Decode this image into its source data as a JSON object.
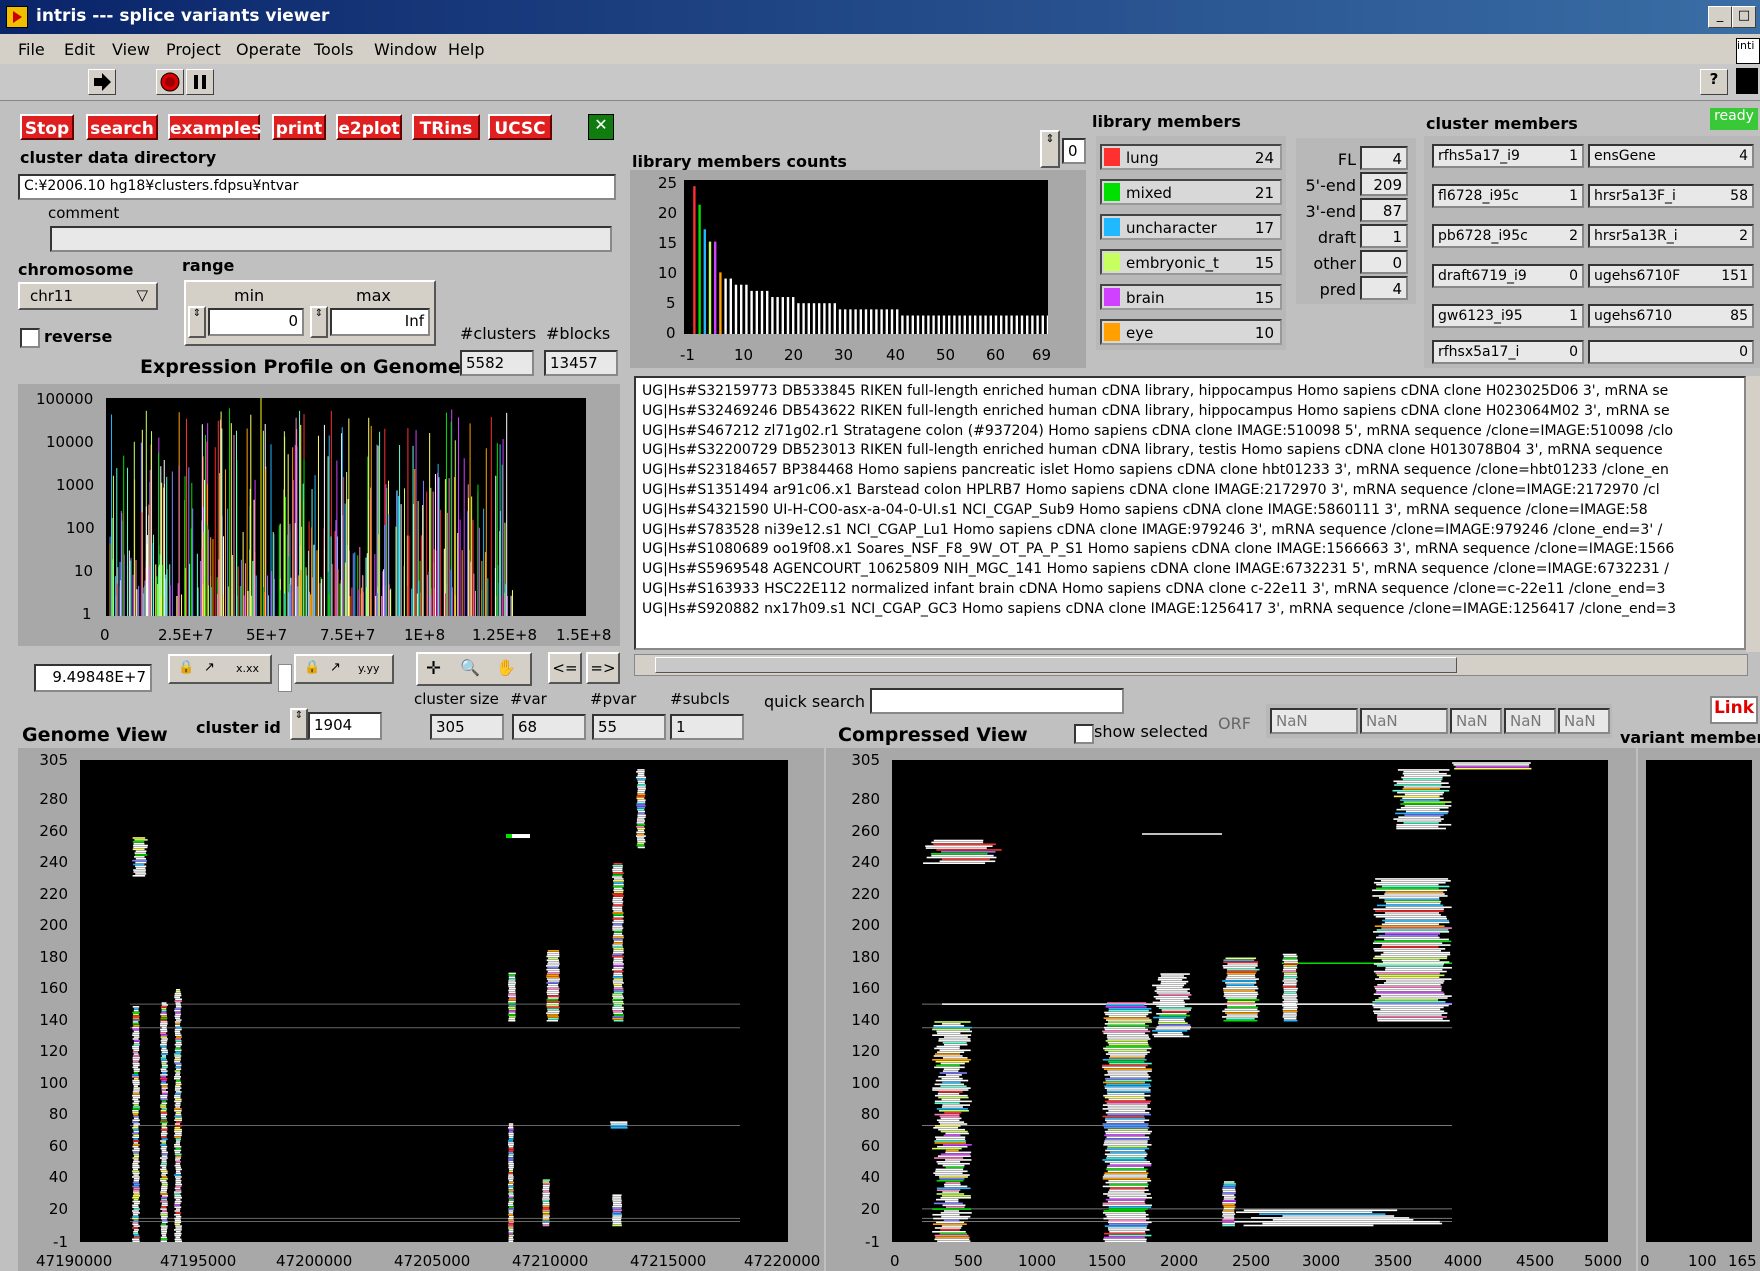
{
  "window": {
    "title": "intris --- splice variants viewer"
  },
  "menu": [
    "File",
    "Edit",
    "View",
    "Project",
    "Operate",
    "Tools",
    "Window",
    "Help"
  ],
  "toolbar": {
    "help": "?"
  },
  "buttons": {
    "stop": "Stop",
    "search": "search",
    "examples": "examples",
    "print": "print",
    "e2plot": "e2plot",
    "trins": "TRins",
    "ucsc": "UCSC"
  },
  "cluster_dir": {
    "label": "cluster data directory",
    "value": "C:¥2006.10 hg18¥clusters.fdpsu¥ntvar",
    "comment_label": "comment",
    "comment": ""
  },
  "chromosome": {
    "label": "chromosome",
    "value": "chr11",
    "reverse_label": "reverse"
  },
  "range": {
    "label": "range",
    "min_label": "min",
    "max_label": "max",
    "min": "0",
    "max": "Inf"
  },
  "counts": {
    "clusters_label": "#clusters",
    "blocks_label": "#blocks",
    "clusters": "5582",
    "blocks": "13457"
  },
  "expression": {
    "title": "Expression Profile on Genome",
    "y_ticks": [
      "100000",
      "10000",
      "1000",
      "100",
      "10",
      "1"
    ],
    "x_ticks": [
      "0",
      "2.5E+7",
      "5E+7",
      "7.5E+7",
      "1E+8",
      "1.25E+8",
      "1.5E+8"
    ],
    "cursor_value": "9.49848E+7",
    "tool_x_fmt": "x.xx",
    "tool_y_fmt": "y.yy",
    "prev": "<=",
    "next": "=>"
  },
  "lib_counts": {
    "title": "library members counts",
    "spin": "0",
    "y_ticks": [
      "25",
      "20",
      "15",
      "10",
      "5",
      "0"
    ],
    "x_ticks": [
      "-1",
      "10",
      "20",
      "30",
      "40",
      "50",
      "60",
      "69"
    ],
    "chart_data": {
      "type": "bar",
      "xlim": [
        -1,
        69
      ],
      "ylim": [
        0,
        25
      ],
      "values": [
        24,
        21,
        17,
        15,
        15,
        10,
        9,
        9,
        8,
        8,
        8,
        7,
        7,
        7,
        7,
        6,
        6,
        6,
        6,
        6,
        5,
        5,
        5,
        5,
        5,
        5,
        5,
        5,
        4,
        4,
        4,
        4,
        4,
        4,
        4,
        4,
        4,
        4,
        4,
        4,
        3,
        3,
        3,
        3,
        3,
        3,
        3,
        3,
        3,
        3,
        3,
        3,
        3,
        3,
        3,
        3,
        3,
        3,
        3,
        3,
        3,
        3,
        3,
        3,
        3,
        3,
        3,
        3,
        3
      ]
    }
  },
  "library_members": {
    "title": "library members",
    "items": [
      {
        "name": "lung",
        "count": "24",
        "color": "#ff3030"
      },
      {
        "name": "mixed",
        "count": "21",
        "color": "#00e000"
      },
      {
        "name": "uncharacter",
        "count": "17",
        "color": "#20b8ff"
      },
      {
        "name": "embryonic_t",
        "count": "15",
        "color": "#c8ff60"
      },
      {
        "name": "brain",
        "count": "15",
        "color": "#d040ff"
      },
      {
        "name": "eye",
        "count": "10",
        "color": "#ffa000"
      }
    ]
  },
  "fl_stats": [
    {
      "label": "FL",
      "value": "4"
    },
    {
      "label": "5'-end",
      "value": "209"
    },
    {
      "label": "3'-end",
      "value": "87"
    },
    {
      "label": "draft",
      "value": "1"
    },
    {
      "label": "other",
      "value": "0"
    },
    {
      "label": "pred",
      "value": "4"
    }
  ],
  "cluster_members": {
    "title": "cluster members",
    "status": "ready",
    "left": [
      {
        "name": "rfhs5a17_i9",
        "value": "1"
      },
      {
        "name": "fl6728_i95c",
        "value": "1"
      },
      {
        "name": "pb6728_i95c",
        "value": "2"
      },
      {
        "name": "draft6719_i9",
        "value": "0"
      },
      {
        "name": "gw6123_i95",
        "value": "1"
      },
      {
        "name": "rfhsx5a17_i",
        "value": "0"
      }
    ],
    "right": [
      {
        "name": "ensGene",
        "value": "4"
      },
      {
        "name": "hrsr5a13F_i",
        "value": "58"
      },
      {
        "name": "hrsr5a13R_i",
        "value": "2"
      },
      {
        "name": "ugehs6710F",
        "value": "151"
      },
      {
        "name": "ugehs6710",
        "value": "85"
      },
      {
        "name": "",
        "value": "0"
      }
    ]
  },
  "sequence_list": [
    "UG|Hs#S32159773 DB533845 RIKEN full-length enriched human cDNA library, hippocampus Homo sapiens cDNA clone H023025D06 3', mRNA se",
    "UG|Hs#S32469246 DB543622 RIKEN full-length enriched human cDNA library, hippocampus Homo sapiens cDNA clone H023064M02 3', mRNA se",
    "UG|Hs#S467212 zl71g02.r1 Stratagene colon (#937204) Homo sapiens cDNA clone IMAGE:510098 5', mRNA sequence /clone=IMAGE:510098 /clo",
    "UG|Hs#S32200729 DB523013 RIKEN full-length enriched human cDNA library, testis Homo sapiens cDNA clone H013078B04 3', mRNA sequence",
    "UG|Hs#S23184657 BP384468 Homo sapiens pancreatic islet Homo sapiens cDNA clone hbt01233 3', mRNA sequence /clone=hbt01233 /clone_en",
    "UG|Hs#S1351494 ar91c06.x1 Barstead colon HPLRB7 Homo sapiens cDNA clone IMAGE:2172970 3', mRNA sequence /clone=IMAGE:2172970 /cl",
    "UG|Hs#S4321590 UI-H-CO0-asx-a-04-0-UI.s1 NCI_CGAP_Sub9 Homo sapiens cDNA clone IMAGE:5860111 3', mRNA sequence /clone=IMAGE:58",
    "UG|Hs#S783528 ni39e12.s1 NCI_CGAP_Lu1 Homo sapiens cDNA clone IMAGE:979246 3', mRNA sequence /clone=IMAGE:979246 /clone_end=3' /",
    "UG|Hs#S1080689 oo19f08.x1 Soares_NSF_F8_9W_OT_PA_P_S1 Homo sapiens cDNA clone IMAGE:1566663 3', mRNA sequence /clone=IMAGE:1566",
    "UG|Hs#S5969548 AGENCOURT_10625809 NIH_MGC_141 Homo sapiens cDNA clone IMAGE:6732231 5', mRNA sequence /clone=IMAGE:6732231 /",
    "UG|Hs#S163933 HSC22E112 normalized infant brain cDNA Homo sapiens cDNA clone c-22e11 3', mRNA sequence /clone=c-22e11 /clone_end=3",
    "UG|Hs#S920882 nx17h09.s1 NCI_CGAP_GC3 Homo sapiens cDNA clone IMAGE:1256417 3', mRNA sequence /clone=IMAGE:1256417 /clone_end=3"
  ],
  "cluster_info": {
    "size_label": "cluster size",
    "var_label": "#var",
    "pvar_label": "#pvar",
    "subcls_label": "#subcls",
    "size": "305",
    "var": "68",
    "pvar": "55",
    "subcls": "1",
    "id_label": "cluster id",
    "id": "1904",
    "quick_search_label": "quick search",
    "quick_search": ""
  },
  "orf": {
    "label": "ORF",
    "values": [
      "NaN",
      "NaN",
      "NaN",
      "NaN",
      "NaN"
    ]
  },
  "genome_view": {
    "title": "Genome View",
    "y_ticks": [
      "305",
      "280",
      "260",
      "240",
      "220",
      "200",
      "180",
      "160",
      "140",
      "120",
      "100",
      "80",
      "60",
      "40",
      "20",
      "-1"
    ],
    "x_ticks": [
      "47190000",
      "47195000",
      "47200000",
      "47205000",
      "47210000",
      "47215000",
      "47220000"
    ]
  },
  "compressed_view": {
    "title": "Compressed View",
    "show_selected": "show selected",
    "y_ticks": [
      "305",
      "280",
      "260",
      "240",
      "220",
      "200",
      "180",
      "160",
      "140",
      "120",
      "100",
      "80",
      "60",
      "40",
      "20",
      "-1"
    ],
    "x_ticks": [
      "0",
      "500",
      "1000",
      "1500",
      "2000",
      "2500",
      "3000",
      "3500",
      "4000",
      "4500",
      "5000"
    ]
  },
  "variant_members": {
    "title": "variant members",
    "link": "Link",
    "x_ticks": [
      "0",
      "100",
      "165"
    ]
  }
}
